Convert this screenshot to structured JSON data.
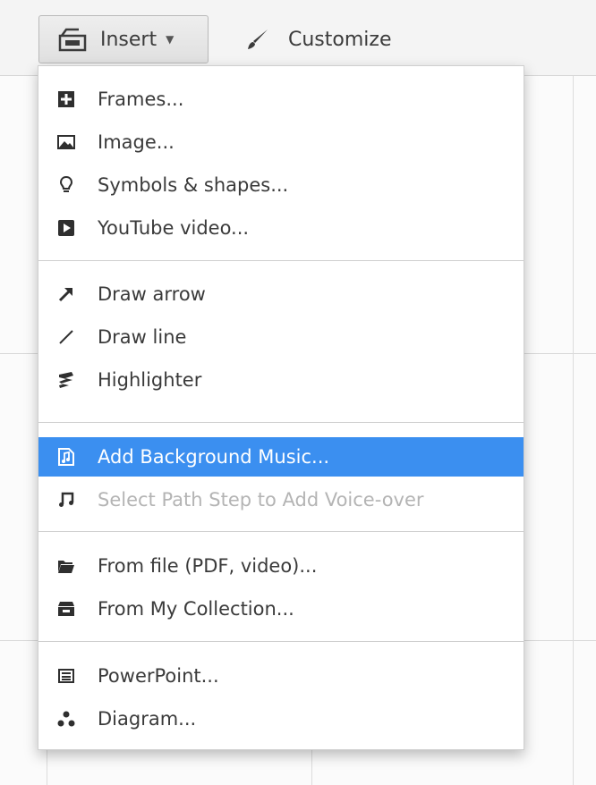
{
  "toolbar": {
    "insert_label": "Insert",
    "customize_label": "Customize"
  },
  "menu": {
    "groups": [
      {
        "items": [
          {
            "label": "Frames...",
            "icon": "frame-plus-icon"
          },
          {
            "label": "Image...",
            "icon": "image-icon"
          },
          {
            "label": "Symbols & shapes...",
            "icon": "lightbulb-icon"
          },
          {
            "label": "YouTube video...",
            "icon": "youtube-play-icon"
          }
        ]
      },
      {
        "items": [
          {
            "label": "Draw arrow",
            "icon": "arrow-icon"
          },
          {
            "label": "Draw line",
            "icon": "line-icon"
          },
          {
            "label": "Highlighter",
            "icon": "highlighter-icon"
          }
        ]
      },
      {
        "items": [
          {
            "label": "Add Background Music...",
            "icon": "music-file-icon",
            "state": "highlighted"
          },
          {
            "label": "Select Path Step to Add Voice-over",
            "icon": "music-note-icon",
            "state": "disabled"
          }
        ]
      },
      {
        "items": [
          {
            "label": "From file (PDF, video)...",
            "icon": "folder-icon"
          },
          {
            "label": "From My Collection...",
            "icon": "collection-box-icon"
          }
        ]
      },
      {
        "items": [
          {
            "label": "PowerPoint...",
            "icon": "powerpoint-icon"
          },
          {
            "label": "Diagram...",
            "icon": "diagram-icon"
          }
        ]
      }
    ]
  },
  "colors": {
    "highlight": "#3b8ff0",
    "disabled_text": "#b4b4b4"
  }
}
